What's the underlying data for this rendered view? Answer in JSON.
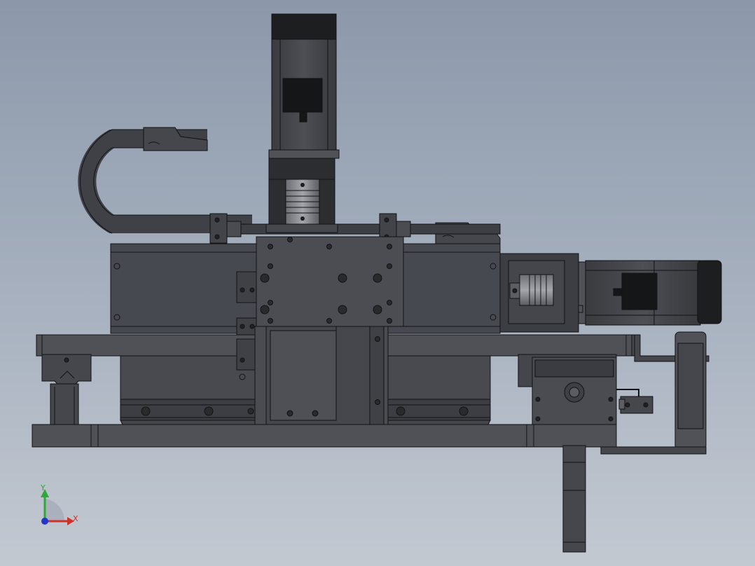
{
  "viewport": {
    "background_top": "#8c98aa",
    "background_bottom": "#c3c9d1"
  },
  "model": {
    "part_color": "#4a4c52",
    "part_dark": "#2a2b2e",
    "edge_color": "#111214",
    "highlight": "#6a6c72"
  },
  "triad": {
    "x_label": "X",
    "y_label": "Y",
    "x_color": "#d0302a",
    "y_color": "#2ea836",
    "z_color": "#2535c8"
  }
}
